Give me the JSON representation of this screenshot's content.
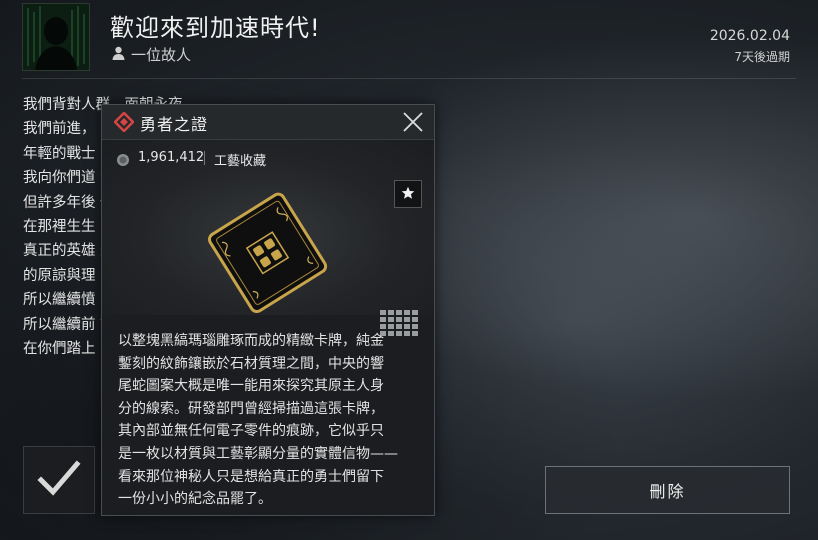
{
  "mail": {
    "title": "歡迎來到加速時代!",
    "sender": "一位故人",
    "date": "2026.02.04",
    "expiry": "7天後過期"
  },
  "body_lines": [
    "我們背對人群，面朝永夜。",
    "我們前進，",
    "年輕的戰士",
    "我向你們道                                                              渴望安逸的常人理解。",
    "但許多年後                                                              你們的名字。因為一群勇士曾向人類證明，光明可以",
    "在那裡生生",
    "真正的英雄                                                              永遠的一腔熱血與壯懷激烈。因此，我不會奢求你們",
    "的原諒與理",
    "所以繼續憤                                                              育中的懦弱與停滯。",
    "所以繼續前                                                              證，已經令黑暗的邊界退卻。",
    "在你們踏上"
  ],
  "actions": {
    "delete_label": "刪除"
  },
  "popup": {
    "title": "勇者之證",
    "price": "1,961,412",
    "category": "工藝收藏",
    "description_lines": [
      "以整塊黑縞瑪瑙雕琢而成的精緻卡牌，純金",
      "鏨刻的紋飾鑲嵌於石材質理之間，中央的響",
      "尾蛇圖案大概是唯一能用來探究其原主人身",
      "分的線索。研發部門曾經掃描過這張卡牌，",
      "其內部並無任何電子零件的痕跡，它似乎只",
      "是一枚以材質與工藝彰顯分量的實體信物——",
      "看來那位神秘人只是想給真正的勇士們留下",
      "一份小小的紀念品罷了。"
    ]
  },
  "colors": {
    "accent_red": "#d64545",
    "gold": "#c8a54a",
    "background": "#1f2428"
  },
  "icons": [
    "person-icon",
    "game-logo-icon",
    "close-icon",
    "coin-icon",
    "star-icon",
    "grid-icon",
    "checkmark-icon"
  ]
}
